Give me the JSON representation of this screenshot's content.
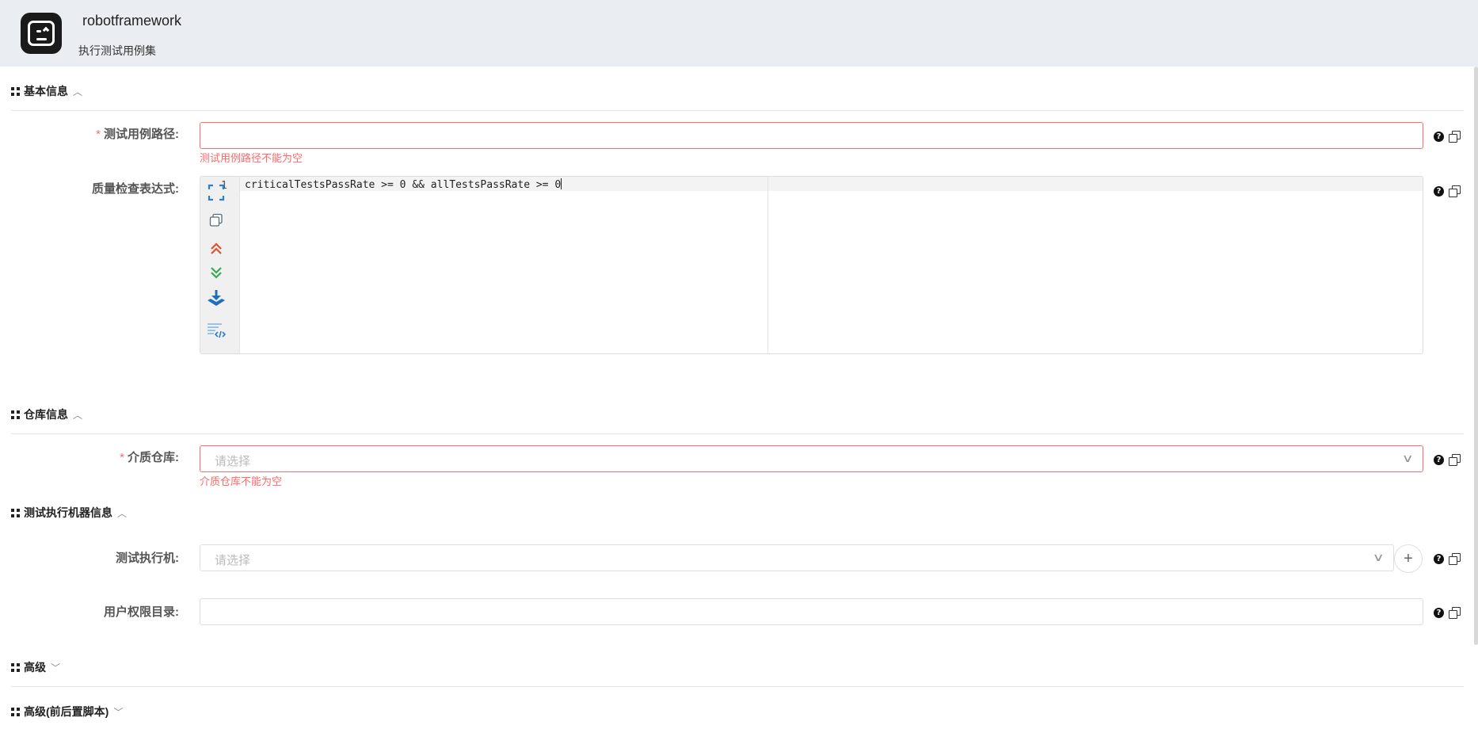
{
  "app": {
    "name": "robotframework",
    "subtitle": "执行测试用例集"
  },
  "sections": {
    "basic": {
      "title": "基本信息",
      "expanded": true
    },
    "repo": {
      "title": "仓库信息",
      "expanded": true
    },
    "machine": {
      "title": "测试执行机器信息",
      "expanded": true
    },
    "advanced": {
      "title": "高级",
      "expanded": false
    },
    "advanced_scripts": {
      "title": "高级(前后置脚本)",
      "expanded": false
    }
  },
  "fields": {
    "test_path": {
      "label": "测试用例路径:",
      "required": "*",
      "value": "",
      "error": "测试用例路径不能为空"
    },
    "quality_expr": {
      "label": "质量检查表达式:",
      "line_number": "1",
      "code": "criticalTestsPassRate >= 0 && allTestsPassRate >= 0"
    },
    "artifact_repo": {
      "label": "介质仓库:",
      "required": "*",
      "placeholder": "请选择",
      "error": "介质仓库不能为空"
    },
    "executor": {
      "label": "测试执行机:",
      "placeholder": "请选择",
      "add_symbol": "+"
    },
    "user_dir": {
      "label": "用户权限目录:",
      "value": ""
    }
  },
  "icons": {
    "help": "?",
    "chevron_up": "︿",
    "chevron_down": "﹀",
    "select_caret": "∨"
  },
  "colors": {
    "error": "#f56c6c",
    "header_bg": "#eaedf2",
    "editor_blue": "#2d7fd1",
    "editor_red": "#e0522d",
    "editor_green": "#3aa757"
  }
}
